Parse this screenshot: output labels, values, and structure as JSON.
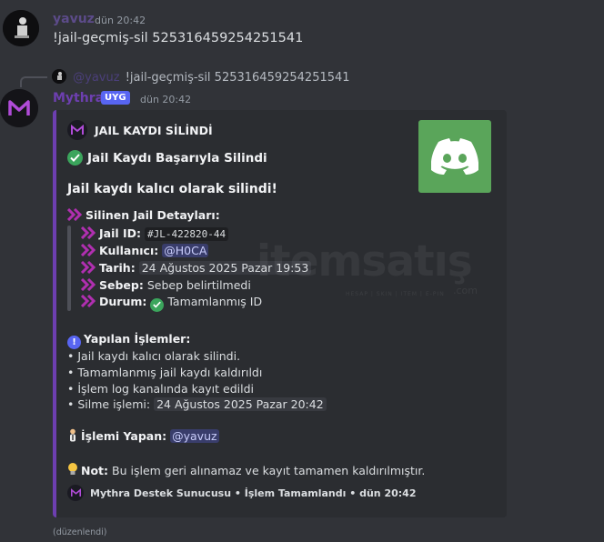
{
  "message1": {
    "username": "yavuz",
    "timestamp": "dün 20:42",
    "content": "!jail-geçmiş-sil 525316459254251541"
  },
  "reply": {
    "mention": "@yavuz",
    "content": "!jail-geçmiş-sil 525316459254251541"
  },
  "message2": {
    "username": "Mythra",
    "badge": "UYG",
    "timestamp": "dün 20:42",
    "edited": "(düzenlendi)"
  },
  "embed": {
    "author": "JAIL KAYDI SİLİNDİ",
    "title": "Jail Kaydı Başarıyla Silindi",
    "headline": "Jail kaydı kalıcı olarak silindi!",
    "details_title": "Silinen Jail Detayları:",
    "details": [
      {
        "key": "Jail ID:",
        "value": "#JL-422820-44"
      },
      {
        "key": "Kullanıcı:",
        "value": "@H0CA"
      },
      {
        "key": "Tarih:",
        "value": "24 Ağustos 2025 Pazar 19:53"
      },
      {
        "key": "Sebep:",
        "value": "Sebep belirtilmedi"
      },
      {
        "key": "Durum:",
        "value": "Tamamlanmış ID"
      }
    ],
    "operations_title": "Yapılan İşlemler:",
    "operations": [
      "• Jail kaydı kalıcı olarak silindi.",
      "• Tamamlanmış jail kaydı kaldırıldı",
      "• İşlem log kanalında kayıt edildi",
      "• Silme işlemi:"
    ],
    "delete_date": "24 Ağustos 2025 Pazar 20:42",
    "performer_label": "İşlemi Yapan:",
    "performer": "@yavuz",
    "note_label": "Not:",
    "note_text": "Bu işlem geri alınamaz ve kayıt tamamen kaldırılmıştır.",
    "footer": "Mythra Destek Sunucusu • İşlem Tamamlandı • dün 20:42",
    "thumbnail_icon": "discord-logo-icon"
  },
  "watermark": {
    "text": "itemsatış",
    "domain": ".com",
    "sub": "HESAP | SKIN | ITEM | E-PIN"
  },
  "colors": {
    "background": "#313338",
    "embed_bg": "#2b2d31",
    "embed_accent": "#6d3fb0",
    "thumbnail": "#5aa55a",
    "chevron": "#b02fb0",
    "check": "#3ba55c",
    "badge": "#5865f2"
  }
}
